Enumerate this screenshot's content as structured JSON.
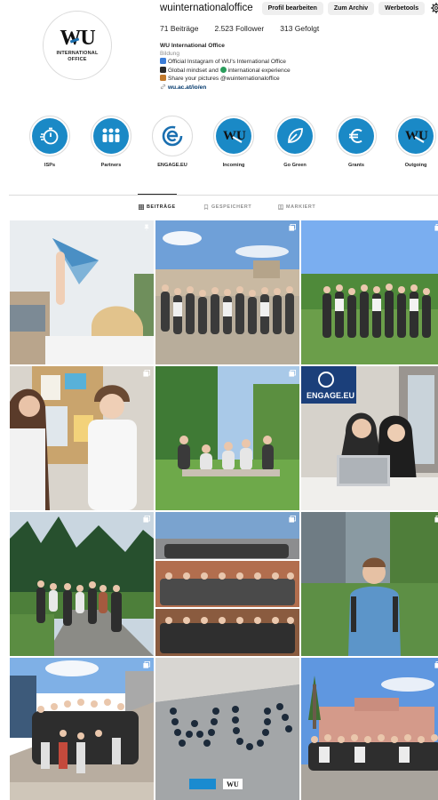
{
  "profile": {
    "username": "wuinternationaloffice",
    "avatar": {
      "logo_text": "WU",
      "logo_subtext_line1": "INTERNATIONAL",
      "logo_subtext_line2": "OFFICE"
    },
    "buttons": {
      "edit_profile": "Profil bearbeiten",
      "archive": "Zum Archiv",
      "ad_tools": "Werbetools"
    },
    "settings_icon": "gear-icon",
    "stats": {
      "posts": "71 Beiträge",
      "followers": "2.523 Follower",
      "following": "313 Gefolgt"
    },
    "bio": {
      "name": "WU International Office",
      "category": "Bildung",
      "line1": "Official Instagram of WU's International Office",
      "line2_a": "Global mindset and",
      "line2_b": "international experience",
      "line3": "Share your pictures @wuinternationaloffice",
      "link": "wu.ac.at/io/en"
    }
  },
  "highlights": [
    {
      "label": "ISPs",
      "icon": "stopwatch-icon"
    },
    {
      "label": "Partners",
      "icon": "people-group-icon"
    },
    {
      "label": "ENGAGE.EU",
      "icon": "engage-eu-logo-icon"
    },
    {
      "label": "Incoming",
      "icon": "wu-logo-icon"
    },
    {
      "label": "Go Green",
      "icon": "leaf-icon"
    },
    {
      "label": "Grants",
      "icon": "euro-icon"
    },
    {
      "label": "Outgoing",
      "icon": "wu-logo-icon"
    }
  ],
  "tabs": [
    {
      "label": "BEITRÄGE",
      "icon": "grid-icon",
      "active": true
    },
    {
      "label": "GESPEICHERT",
      "icon": "bookmark-icon",
      "active": false
    },
    {
      "label": "MARKIERT",
      "icon": "tagged-icon",
      "active": false
    }
  ],
  "posts": [
    {
      "description": "paper-plane-map",
      "icon": "pinned-icon"
    },
    {
      "description": "group-city-view",
      "icon": "carousel-icon"
    },
    {
      "description": "group-vineyard",
      "icon": "carousel-icon"
    },
    {
      "description": "students-bulletin-board",
      "icon": "carousel-icon"
    },
    {
      "description": "picnic-park",
      "icon": "carousel-icon"
    },
    {
      "description": "engage-eu-laptop",
      "overlay_text": "ENGAGE.EU",
      "icon": ""
    },
    {
      "description": "forest-walk",
      "icon": "carousel-icon"
    },
    {
      "description": "group-collage",
      "icon": "carousel-icon"
    },
    {
      "description": "student-backpack",
      "icon": "carousel-icon"
    },
    {
      "description": "stairs-group",
      "icon": "carousel-icon"
    },
    {
      "description": "people-forming-letters",
      "overlay_text": "WU",
      "icon": ""
    },
    {
      "description": "group-palace-square",
      "icon": "carousel-icon"
    }
  ],
  "colors": {
    "accent_blue": "#1a89c6",
    "link": "#00376b",
    "muted": "#8e8e8e"
  }
}
